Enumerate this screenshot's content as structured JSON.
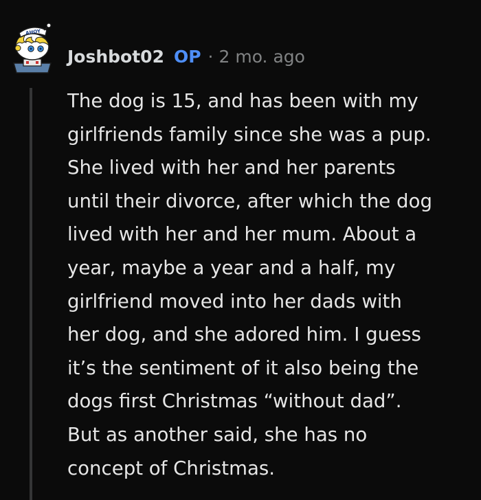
{
  "comment": {
    "author": "Joshbot02",
    "op_label": "OP",
    "separator": "·",
    "timestamp": "2 mo. ago",
    "avatar": {
      "icon": "snoo-sailor-avatar-icon",
      "hat_text": "AHOY"
    },
    "body_lines": [
      "The dog is 15, and has been with my",
      "girlfriends family since she was a pup.",
      "She lived with her and her parents",
      "until their divorce, after which the dog",
      "lived with her and her mum. About a",
      "year, maybe a year and a half, my",
      "girlfriend moved into her dads with",
      "her dog, and she adored him. I guess",
      "it’s the sentiment of it also being the",
      "dogs first Christmas “without dad”.",
      "But as another said, she has no",
      "concept of Christmas."
    ]
  },
  "colors": {
    "background": "#0b0b0b",
    "text": "#d7dadc",
    "op_badge": "#4e8ef7",
    "meta": "#818384",
    "thread_line": "#343536"
  }
}
